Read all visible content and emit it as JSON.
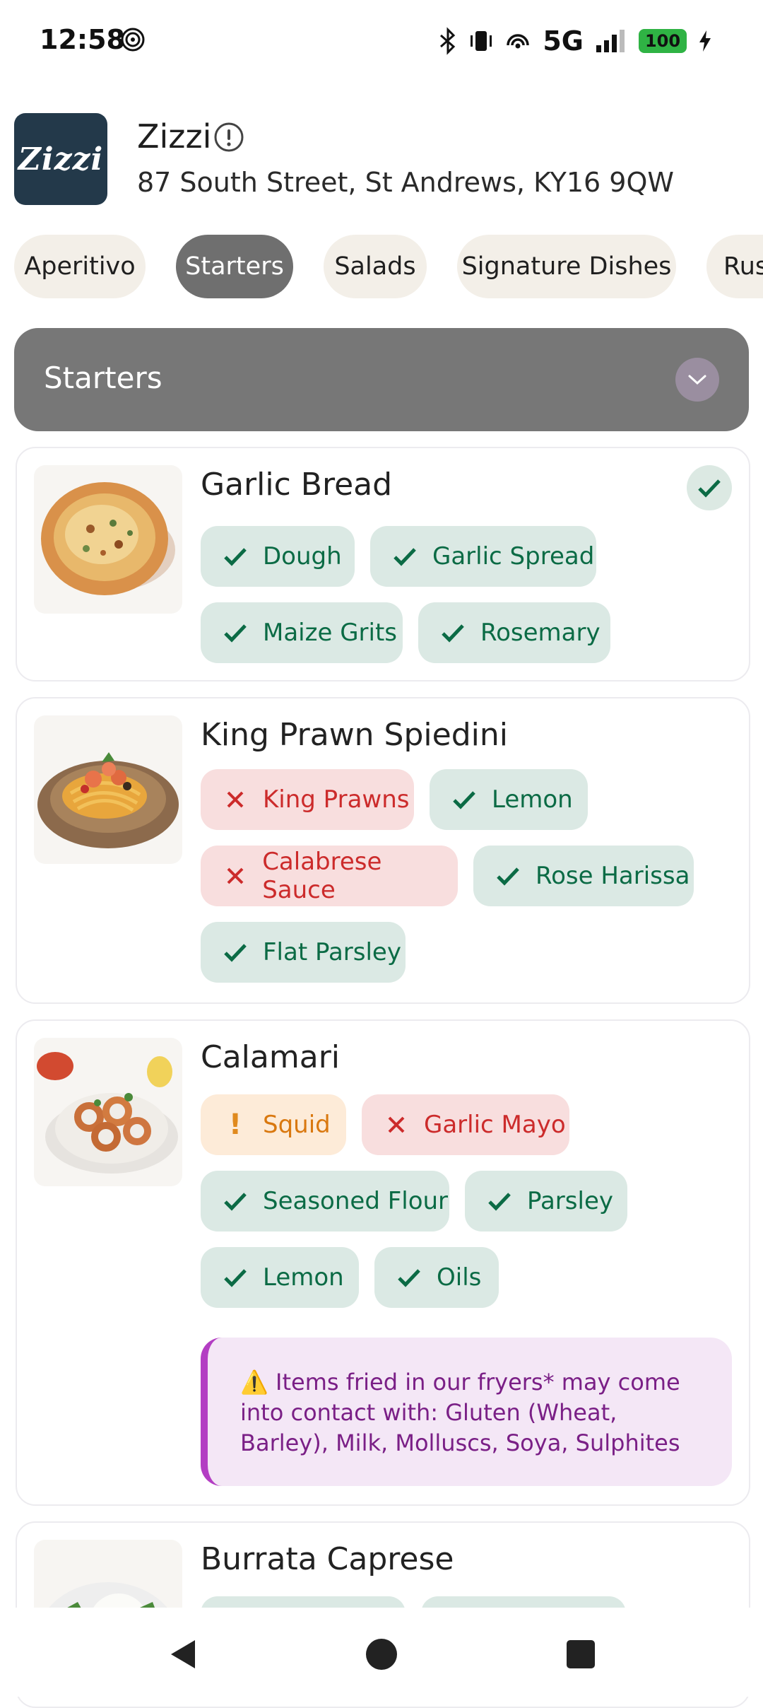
{
  "status": {
    "time": "12:58",
    "network": "5G",
    "battery": "100"
  },
  "restaurant": {
    "name": "Zizzi",
    "logo_text": "Zizzi",
    "address": "87 South Street, St Andrews, KY16 9QW"
  },
  "categories": [
    {
      "label": "Aperitivo",
      "active": false
    },
    {
      "label": "Starters",
      "active": true
    },
    {
      "label": "Salads",
      "active": false
    },
    {
      "label": "Signature Dishes",
      "active": false
    },
    {
      "label": "Rustic",
      "active": false
    }
  ],
  "section": {
    "title": "Starters"
  },
  "dishes": [
    {
      "name": "Garlic Bread",
      "selected": true,
      "ingredients": [
        {
          "label": "Dough",
          "status": "ok"
        },
        {
          "label": "Garlic Spread",
          "status": "ok"
        },
        {
          "label": "Maize Grits",
          "status": "ok"
        },
        {
          "label": "Rosemary",
          "status": "ok"
        }
      ]
    },
    {
      "name": "King Prawn Spiedini",
      "selected": false,
      "ingredients": [
        {
          "label": "King Prawns",
          "status": "no"
        },
        {
          "label": "Lemon",
          "status": "ok"
        },
        {
          "label": "Calabrese Sauce",
          "status": "no"
        },
        {
          "label": "Rose Harissa",
          "status": "ok"
        },
        {
          "label": "Flat Parsley",
          "status": "ok"
        }
      ]
    },
    {
      "name": "Calamari",
      "selected": false,
      "ingredients": [
        {
          "label": "Squid",
          "status": "warn"
        },
        {
          "label": "Garlic Mayo",
          "status": "no"
        },
        {
          "label": "Seasoned Flour",
          "status": "ok"
        },
        {
          "label": "Parsley",
          "status": "ok"
        },
        {
          "label": "Lemon",
          "status": "ok"
        },
        {
          "label": "Oils",
          "status": "ok"
        }
      ],
      "notice": "⚠️ Items fried in our fryers* may come into contact with: Gluten (Wheat, Barley), Milk, Molluscs, Soya, Sulphites"
    },
    {
      "name": "Burrata Caprese"
    }
  ],
  "colors": {
    "ok": "#0b6b45",
    "no": "#cc2b2b",
    "warn": "#d9780f",
    "notice": "#b33ec3",
    "logo_bg": "#23394a"
  },
  "icons": {
    "ok": "check-icon",
    "no": "cross-icon",
    "warn": "exclamation-icon"
  }
}
